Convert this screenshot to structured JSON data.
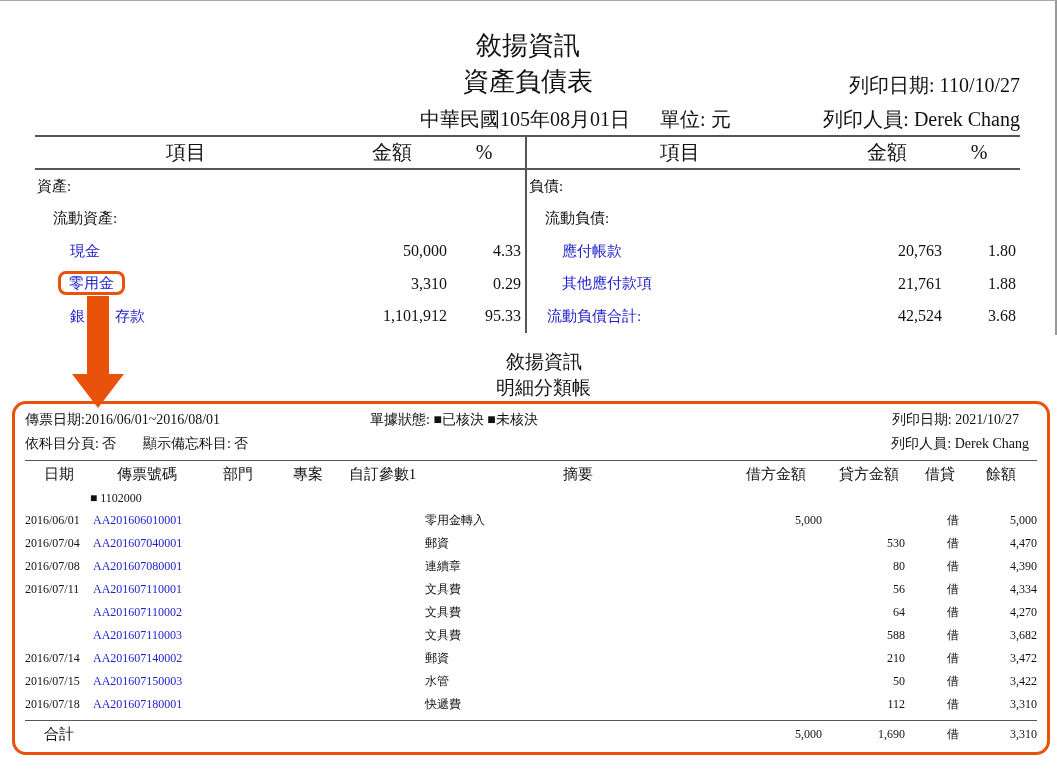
{
  "balance_sheet": {
    "company": "敘揚資訊",
    "title": "資產負債表",
    "print_date": "列印日期: 110/10/27",
    "date_line": "中華民國105年08月01日",
    "unit": "單位: 元",
    "printed_by": "列印人員: Derek Chang",
    "halves": [
      {
        "columns": [
          "項目",
          "金額",
          "%"
        ],
        "rows": [
          {
            "kind": "section",
            "item": "資產:"
          },
          {
            "kind": "group",
            "item": "流動資產:"
          },
          {
            "kind": "account",
            "item": "現金",
            "amount": "50,000",
            "percent": "4.33",
            "highlighted": false
          },
          {
            "kind": "account",
            "item": "零用金",
            "amount": "3,310",
            "percent": "0.29",
            "highlighted": true
          },
          {
            "kind": "account",
            "item": "銀",
            "item_continued": "存款",
            "amount": "1,101,912",
            "percent": "95.33",
            "highlighted": false
          }
        ]
      },
      {
        "columns": [
          "項目",
          "金額",
          "%"
        ],
        "rows": [
          {
            "kind": "section",
            "item": "負債:"
          },
          {
            "kind": "group",
            "item": "流動負債:"
          },
          {
            "kind": "account",
            "item": "應付帳款",
            "amount": "20,763",
            "percent": "1.80",
            "highlighted": false
          },
          {
            "kind": "account",
            "item": "其他應付款項",
            "amount": "21,761",
            "percent": "1.88",
            "highlighted": false
          },
          {
            "kind": "subtotal",
            "item": "流動負債合計:",
            "amount": "42,524",
            "percent": "3.68",
            "highlighted": false
          }
        ]
      }
    ]
  },
  "ledger": {
    "company": "敘揚資訊",
    "title": "明細分類帳",
    "voucher_date": "傳票日期:2016/06/01~2016/08/01",
    "document_status": "單據狀態: ■已核決 ■未核決",
    "print_date": "列印日期: 2021/10/27",
    "page_by_account": "依科目分頁: 否",
    "show_memo_accounts": "顯示備忘科目: 否",
    "printed_by": "列印人員: Derek Chang",
    "columns": [
      "日期",
      "傳票號碼",
      "部門",
      "專案",
      "自訂參數1",
      "摘要",
      "借方金額",
      "貸方金額",
      "借貸",
      "餘額"
    ],
    "account": "■ 1102000",
    "rows": [
      {
        "date": "2016/06/01",
        "voucher": "AA201606010001",
        "summary": "零用金轉入",
        "debit": "5,000",
        "dc": "借",
        "balance": "5,000"
      },
      {
        "date": "2016/07/04",
        "voucher": "AA201607040001",
        "summary": "郵資",
        "credit": "530",
        "dc": "借",
        "balance": "4,470"
      },
      {
        "date": "2016/07/08",
        "voucher": "AA201607080001",
        "summary": "連續章",
        "credit": "80",
        "dc": "借",
        "balance": "4,390"
      },
      {
        "date": "2016/07/11",
        "voucher": "AA201607110001",
        "summary": "文具費",
        "credit": "56",
        "dc": "借",
        "balance": "4,334"
      },
      {
        "voucher": "AA201607110002",
        "summary": "文具費",
        "credit": "64",
        "dc": "借",
        "balance": "4,270"
      },
      {
        "voucher": "AA201607110003",
        "summary": "文具費",
        "credit": "588",
        "dc": "借",
        "balance": "3,682"
      },
      {
        "date": "2016/07/14",
        "voucher": "AA201607140002",
        "summary": "郵資",
        "credit": "210",
        "dc": "借",
        "balance": "3,472"
      },
      {
        "date": "2016/07/15",
        "voucher": "AA201607150003",
        "summary": "水管",
        "credit": "50",
        "dc": "借",
        "balance": "3,422"
      },
      {
        "date": "2016/07/18",
        "voucher": "AA201607180001",
        "summary": "快遞費",
        "credit": "112",
        "dc": "借",
        "balance": "3,310"
      }
    ],
    "total": {
      "label": "合計",
      "debit": "5,000",
      "credit": "1,690",
      "dc": "借",
      "balance": "3,310"
    }
  }
}
